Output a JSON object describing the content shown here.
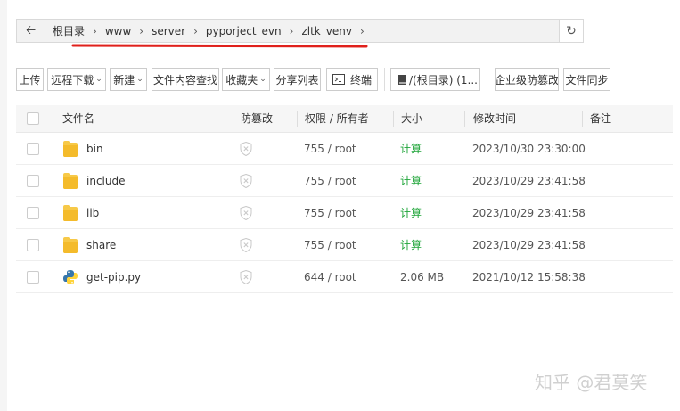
{
  "pathbar": {
    "crumbs": [
      "根目录",
      "www",
      "server",
      "pyporject_evn",
      "zltk_venv"
    ],
    "back_icon": "arrow-left-icon",
    "refresh_icon": "refresh-icon"
  },
  "toolbar": {
    "upload": "上传",
    "remote_download": "远程下载",
    "new": "新建",
    "content_search": "文件内容查找",
    "favorites": "收藏夹",
    "share_list": "分享列表",
    "terminal": "终端",
    "disk": "/(根目录) (1...",
    "tamper_proof": "企业级防篡改",
    "file_sync": "文件同步"
  },
  "table": {
    "headers": {
      "name": "文件名",
      "tamper": "防篡改",
      "perm": "权限 / 所有者",
      "size": "大小",
      "mtime": "修改时间",
      "note": "备注"
    },
    "rows": [
      {
        "name": "bin",
        "type": "folder",
        "perm": "755 / root",
        "size": "计算",
        "mtime": "2023/10/30 23:30:00"
      },
      {
        "name": "include",
        "type": "folder",
        "perm": "755 / root",
        "size": "计算",
        "mtime": "2023/10/29 23:41:58"
      },
      {
        "name": "lib",
        "type": "folder",
        "perm": "755 / root",
        "size": "计算",
        "mtime": "2023/10/29 23:41:58"
      },
      {
        "name": "share",
        "type": "folder",
        "perm": "755 / root",
        "size": "计算",
        "mtime": "2023/10/29 23:41:58"
      },
      {
        "name": "get-pip.py",
        "type": "python",
        "perm": "644 / root",
        "size": "2.06 MB",
        "mtime": "2021/10/12 15:58:38"
      }
    ]
  },
  "watermark": "知乎 @君莫笑",
  "colors": {
    "accent_green": "#20a53a",
    "annotation_red": "#e0201b",
    "folder_yellow": "#f7c948"
  }
}
